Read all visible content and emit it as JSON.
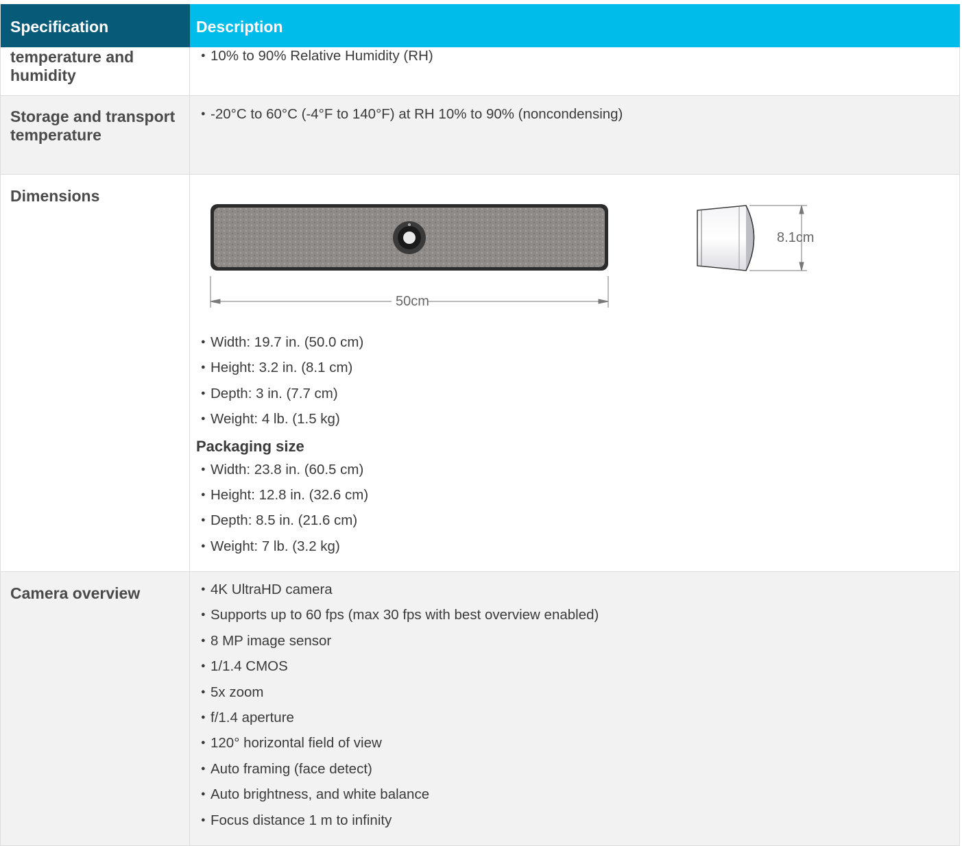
{
  "header": {
    "spec": "Specification",
    "desc": "Description"
  },
  "rows": [
    {
      "spec": "temperature and humidity",
      "items": [
        "10% to 90% Relative Humidity (RH)"
      ]
    },
    {
      "spec": "Storage and transport temperature",
      "items": [
        "-20°C to 60°C (-4°F to 140°F) at RH 10% to 90% (noncondensing)"
      ]
    },
    {
      "spec": "Dimensions",
      "drawing": {
        "width_label": "50cm",
        "height_label": "8.1cm"
      },
      "items": [
        "Width: 19.7 in. (50.0 cm)",
        "Height: 3.2 in. (8.1 cm)",
        "Depth: 3 in. (7.7 cm)",
        "Weight: 4 lb. (1.5 kg)"
      ],
      "packaging_title": "Packaging size",
      "packaging_items": [
        "Width: 23.8 in. (60.5 cm)",
        "Height: 12.8 in. (32.6 cm)",
        "Depth: 8.5 in. (21.6 cm)",
        "Weight: 7 lb. (3.2 kg)"
      ]
    },
    {
      "spec": "Camera overview",
      "items": [
        "4K UltraHD camera",
        "Supports up to 60 fps (max 30 fps with best overview enabled)",
        "8 MP image sensor",
        "1/1.4 CMOS",
        "5x zoom",
        "f/1.4 aperture",
        "120° horizontal field of view",
        "Auto framing (face detect)",
        "Auto brightness, and white balance",
        "Focus distance 1 m to infinity"
      ]
    }
  ]
}
